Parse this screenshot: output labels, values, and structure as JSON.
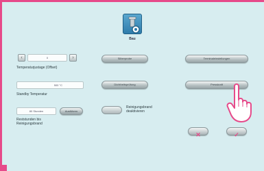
{
  "header": {
    "icon": "furnace-tool-icon",
    "label": "Bau"
  },
  "left_panel": {
    "temperature_offset": {
      "decrement_label": "‹",
      "value": "0",
      "increment_label": "›",
      "label": "Temperaturjustage (Offset)"
    },
    "standby": {
      "value": "500 °C",
      "label": "Standby Temperatur"
    },
    "remaining_hours": {
      "value": "80 Stunden",
      "button_label": "Ausführen",
      "label": "Reststunden bis Reinigungsbrand"
    }
  },
  "center_panel": {
    "silver_test_label": "Silberprobe",
    "vacuum_test_label": "Dichtheitsprüfung",
    "cleaning_toggle_label": "Reinigungsbrand deaktivieren"
  },
  "right_panel": {
    "terminal_settings_label": "Terminaleinstellungen",
    "preset_label": "Presskraft"
  },
  "footer": {
    "cancel_symbol": "✕",
    "confirm_symbol": "✓",
    "accent_color": "#e64a8a"
  }
}
